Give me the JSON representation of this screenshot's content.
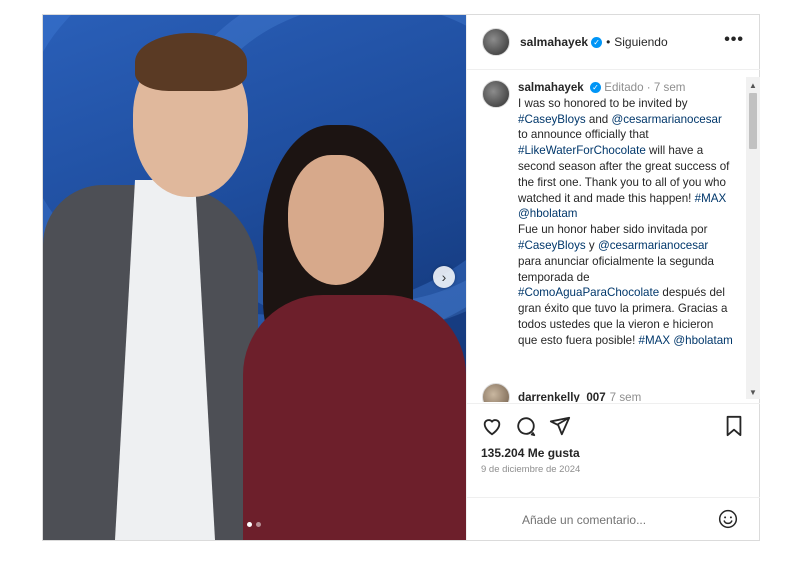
{
  "header": {
    "username": "salmahayek",
    "separator": "•",
    "follow_status": "Siguiendo",
    "more": "•••"
  },
  "caption": {
    "username": "salmahayek",
    "edited": "Editado",
    "dot": "·",
    "time": "7 sem",
    "en_1": "I was so honored to be invited by",
    "tag_casey": "#CaseyBloys",
    "and": "and",
    "tag_cesar": "@cesarmarianocesar",
    "en_2": "to announce officially that",
    "tag_show_en": "#LikeWaterForChocolate",
    "en_3": "will have a second season after the great success of the first one. Thank you to all of you who watched it and made this happen!",
    "tag_max": "#MAX",
    "tag_hbo": "@hbolatam",
    "es_1": "Fue un honor haber sido invitada por",
    "tag_casey_es": "#CaseyBloys",
    "y": "y",
    "tag_cesar_es": "@cesarmarianocesar",
    "es_2": "para anunciar oficialmente la segunda temporada de",
    "tag_show_es": "#ComoAguaParaChocolate",
    "es_3": "después del gran éxito que tuvo la primera. Gracias a todos ustedes que la vieron e hicieron que esto fuera posible!",
    "tag_max_es": "#MAX",
    "tag_hbo_es": "@hbolatam"
  },
  "reply": {
    "username": "darrenkelly_007",
    "time": "7 sem"
  },
  "stats": {
    "likes": "135.204 Me gusta",
    "date": "9 de diciembre de 2024"
  },
  "comment_box": {
    "placeholder": "Añade un comentario..."
  },
  "carousel": {
    "next": "›",
    "current_slide": 1,
    "total_slides": 2
  },
  "colors": {
    "link": "#00376b",
    "verified": "#0095f6"
  }
}
